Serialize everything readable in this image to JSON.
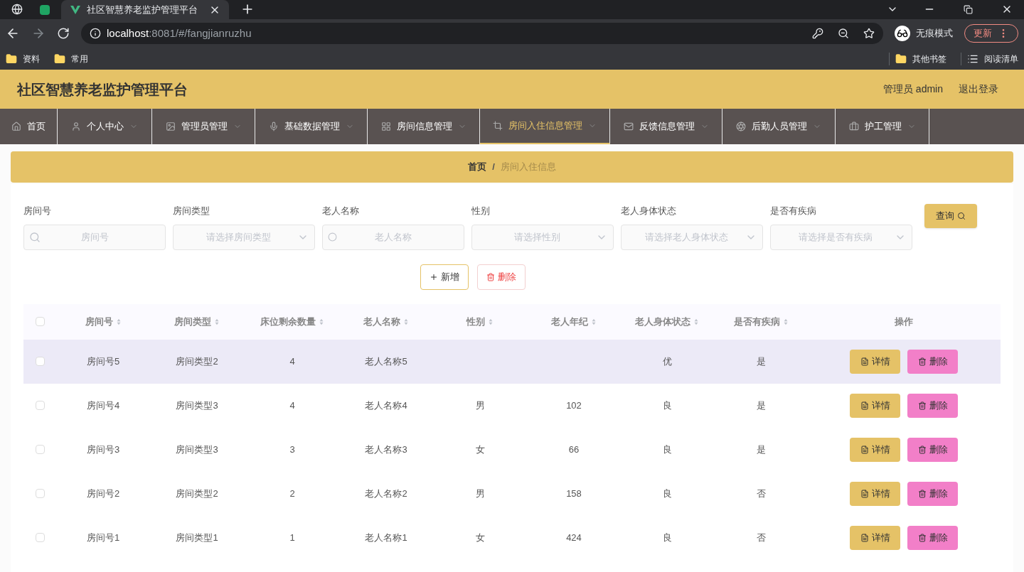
{
  "browser": {
    "tabs": [
      {
        "title": "社区智慧养老监护管理平台",
        "selected": true
      }
    ],
    "url_host": "localhost",
    "url_path": ":8081/#/fangjianruzhu",
    "incognito_label": "无痕模式",
    "update_label": "更新",
    "bookmarks": [
      "资料",
      "常用"
    ],
    "bookmarks_right": [
      {
        "label": "其他书签",
        "kind": "folder"
      },
      {
        "label": "阅读清单",
        "kind": "list"
      }
    ]
  },
  "header": {
    "title": "社区智慧养老监护管理平台",
    "user": "管理员 admin",
    "logout": "退出登录"
  },
  "nav": [
    {
      "label": "首页",
      "selected": false,
      "dropdown": false
    },
    {
      "label": "个人中心",
      "selected": false,
      "dropdown": true
    },
    {
      "label": "管理员管理",
      "selected": false,
      "dropdown": true
    },
    {
      "label": "基础数据管理",
      "selected": false,
      "dropdown": true
    },
    {
      "label": "房间信息管理",
      "selected": false,
      "dropdown": true
    },
    {
      "label": "房间入住信息管理",
      "selected": true,
      "dropdown": true
    },
    {
      "label": "反馈信息管理",
      "selected": false,
      "dropdown": true
    },
    {
      "label": "后勤人员管理",
      "selected": false,
      "dropdown": true
    },
    {
      "label": "护工管理",
      "selected": false,
      "dropdown": true
    }
  ],
  "breadcrumb": {
    "items": [
      "首页",
      "房间入住信息"
    ],
    "separator": "/"
  },
  "filters": [
    {
      "label": "房间号",
      "placeholder": "房间号",
      "kind": "search"
    },
    {
      "label": "房间类型",
      "placeholder": "请选择房间类型",
      "kind": "select"
    },
    {
      "label": "老人名称",
      "placeholder": "老人名称",
      "kind": "input"
    },
    {
      "label": "性别",
      "placeholder": "请选择性别",
      "kind": "select"
    },
    {
      "label": "老人身体状态",
      "placeholder": "请选择老人身体状态",
      "kind": "select"
    },
    {
      "label": "是否有疾病",
      "placeholder": "请选择是否有疾病",
      "kind": "select"
    }
  ],
  "search_button": "查询",
  "actions": [
    {
      "label": "新增",
      "kind": "add"
    },
    {
      "label": "删除",
      "kind": "delete"
    }
  ],
  "table": {
    "header_checked": false,
    "columns": [
      {
        "label": "房间号",
        "sortable": true
      },
      {
        "label": "房间类型",
        "sortable": true
      },
      {
        "label": "床位剩余数量",
        "sortable": true
      },
      {
        "label": "老人名称",
        "sortable": true
      },
      {
        "label": "性别",
        "sortable": true
      },
      {
        "label": "老人年纪",
        "sortable": true
      },
      {
        "label": "老人身体状态",
        "sortable": true
      },
      {
        "label": "是否有疾病",
        "sortable": true
      },
      {
        "label": "操作",
        "sortable": false
      }
    ],
    "rows": [
      {
        "checked": false,
        "hovered": true,
        "cells": [
          "房间号5",
          "房间类型2",
          "4",
          "老人名称5",
          null,
          null,
          "优",
          "是"
        ],
        "actions": [
          {
            "label": "详情",
            "kind": "detail"
          },
          {
            "label": "删除",
            "kind": "delete"
          }
        ]
      },
      {
        "checked": false,
        "hovered": false,
        "cells": [
          "房间号4",
          "房间类型3",
          "4",
          "老人名称4",
          "男",
          "102",
          "良",
          "是"
        ],
        "actions": [
          {
            "label": "详情",
            "kind": "detail"
          },
          {
            "label": "删除",
            "kind": "delete"
          }
        ]
      },
      {
        "checked": false,
        "hovered": false,
        "cells": [
          "房间号3",
          "房间类型3",
          "3",
          "老人名称3",
          "女",
          "66",
          "良",
          "是"
        ],
        "actions": [
          {
            "label": "详情",
            "kind": "detail"
          },
          {
            "label": "删除",
            "kind": "delete"
          }
        ]
      },
      {
        "checked": false,
        "hovered": false,
        "cells": [
          "房间号2",
          "房间类型2",
          "2",
          "老人名称2",
          "男",
          "158",
          "良",
          "否"
        ],
        "actions": [
          {
            "label": "详情",
            "kind": "detail"
          },
          {
            "label": "删除",
            "kind": "delete"
          }
        ]
      },
      {
        "checked": false,
        "hovered": false,
        "cells": [
          "房间号1",
          "房间类型1",
          "1",
          "老人名称1",
          "女",
          "424",
          "良",
          "否"
        ],
        "actions": [
          {
            "label": "详情",
            "kind": "detail"
          },
          {
            "label": "删除",
            "kind": "delete"
          }
        ]
      }
    ]
  }
}
